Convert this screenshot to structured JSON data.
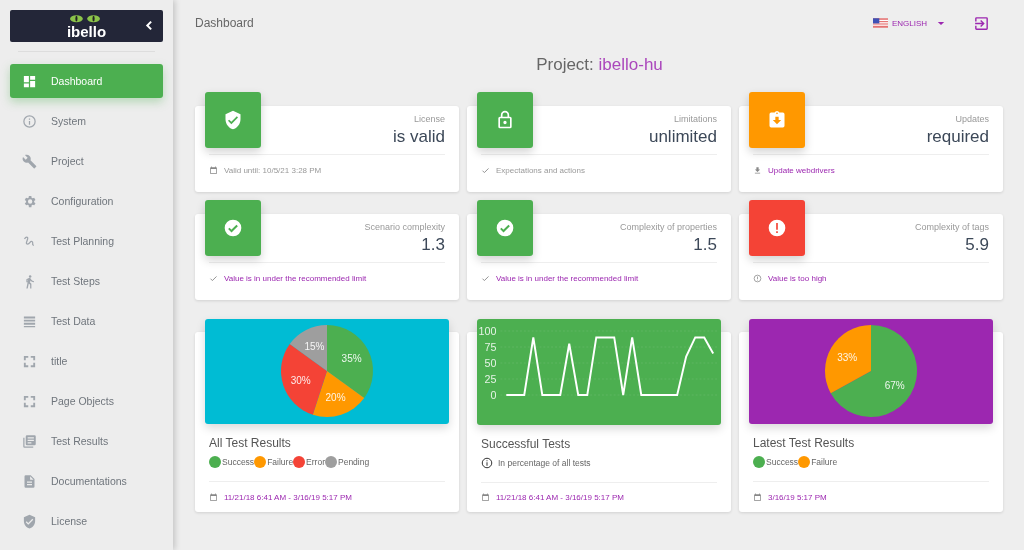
{
  "sidebar": {
    "logo": "ibello",
    "items": [
      {
        "label": "Dashboard",
        "kind": "dashboard",
        "selected": true
      },
      {
        "label": "System",
        "kind": "info",
        "selected": false
      },
      {
        "label": "Project",
        "kind": "wrench",
        "selected": false
      },
      {
        "label": "Configuration",
        "kind": "gear",
        "selected": false
      },
      {
        "label": "Test Planning",
        "kind": "squiggle",
        "selected": false
      },
      {
        "label": "Test Steps",
        "kind": "walk",
        "selected": false
      },
      {
        "label": "Test Data",
        "kind": "list",
        "selected": false
      },
      {
        "label": "title",
        "kind": "frame",
        "selected": false
      },
      {
        "label": "Page Objects",
        "kind": "frame",
        "selected": false
      },
      {
        "label": "Test Results",
        "kind": "library",
        "selected": false
      },
      {
        "label": "Documentations",
        "kind": "doc",
        "selected": false
      },
      {
        "label": "License",
        "kind": "shield",
        "selected": false
      }
    ]
  },
  "header": {
    "breadcrumb": "Dashboard",
    "language": "ENGLISH"
  },
  "project": {
    "label": "Project:",
    "name": "ibello-hu"
  },
  "stats": [
    {
      "kind": "shield",
      "color": "#4caf50",
      "title": "License",
      "value": "is valid",
      "footer": {
        "kind": "calendar",
        "text": "Valid until: 10/5/21 3:28 PM",
        "link": false
      }
    },
    {
      "kind": "lock",
      "color": "#4caf50",
      "title": "Limitations",
      "value": "unlimited",
      "footer": {
        "kind": "check",
        "text": "Expectations and actions",
        "link": false
      }
    },
    {
      "kind": "clipboard",
      "color": "#ff9800",
      "title": "Updates",
      "value": "required",
      "footer": {
        "kind": "download",
        "text": "Update webdrivers",
        "link": true
      }
    },
    {
      "kind": "check",
      "color": "#4caf50",
      "title": "Scenario complexity",
      "value": "1.3",
      "footer": {
        "kind": "check",
        "text": "Value is in under the recommended limit",
        "link": true
      }
    },
    {
      "kind": "check",
      "color": "#4caf50",
      "title": "Complexity of properties",
      "value": "1.5",
      "footer": {
        "kind": "check",
        "text": "Value is in under the recommended limit",
        "link": true
      }
    },
    {
      "kind": "alert",
      "color": "#f44336",
      "title": "Complexity of tags",
      "value": "5.9",
      "footer": {
        "kind": "info",
        "text": "Value is too high",
        "link": true
      }
    }
  ],
  "charts": [
    {
      "title": "All Test Results",
      "color": "#00bcd4",
      "footer": "11/21/18 6:41 AM - 3/16/19 5:17 PM",
      "chart_data": {
        "type": "pie",
        "categories": [
          "Success",
          "Failure",
          "Error",
          "Pending"
        ],
        "values": [
          35,
          20,
          30,
          15
        ],
        "value_labels": [
          "35%",
          "20%",
          "30%",
          "15%"
        ]
      }
    },
    {
      "title": "Successful Tests",
      "color": "#4caf50",
      "note": "In percentage of all tests",
      "footer": "11/21/18 6:41 AM - 3/16/19 5:17 PM",
      "chart_data": {
        "type": "line",
        "grid": true,
        "ylim": [
          0,
          100
        ],
        "yticks": [
          0,
          25,
          50,
          75,
          100
        ],
        "series": [
          {
            "color": "#ffffff",
            "values": [
              0,
              0,
              0,
              90,
              0,
              0,
              0,
              80,
              0,
              0,
              90,
              90,
              90,
              0,
              90,
              0,
              0,
              0,
              0,
              0,
              60,
              90,
              90,
              65
            ]
          }
        ]
      }
    },
    {
      "title": "Latest Test Results",
      "color": "#9c27b0",
      "footer": "3/16/19 5:17 PM",
      "chart_data": {
        "type": "pie",
        "categories": [
          "Success",
          "Failure"
        ],
        "values": [
          67,
          33
        ],
        "value_labels": [
          "67%",
          "33%"
        ]
      }
    }
  ]
}
